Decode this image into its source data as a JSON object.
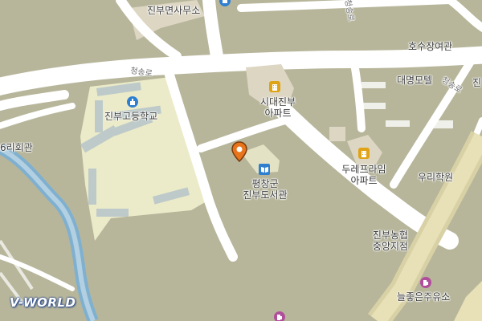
{
  "map": {
    "colors": {
      "background": "#b7b69b",
      "road": "#ffffff",
      "school_area": "#ecebc9",
      "river": "#7fb0d0",
      "building": "#ddd6c3"
    },
    "road_labels": {
      "cheongsong_top": "청송로",
      "cheongsong_left": "청송로",
      "cheongsong_right": "청송로"
    },
    "places": {
      "myeon_office": "진부면사무소",
      "hosu_hall": "호수장여관",
      "daemyeong_motel": "대명모텔",
      "right_edge": "진",
      "highschool": "진부고등학교",
      "sidae_apt_line1": "시대진부",
      "sidae_apt_line2": "아파트",
      "left_hall": "6리회관",
      "library_line1": "평창군",
      "library_line2": "진부도서관",
      "dreprime_line1": "두레프라임",
      "dreprime_line2": "아파트",
      "uri_academy": "우리학원",
      "nonghyup_line1": "진부농협",
      "nonghyup_line2": "중앙지점",
      "gas_station": "늘좋은주유소"
    },
    "icons": {
      "office": "government-office-icon",
      "school": "school-icon",
      "apartment": "apartment-icon",
      "library": "library-icon",
      "gas": "gas-station-icon",
      "marker": "location-marker-icon"
    },
    "logo": "V-WORLD"
  }
}
